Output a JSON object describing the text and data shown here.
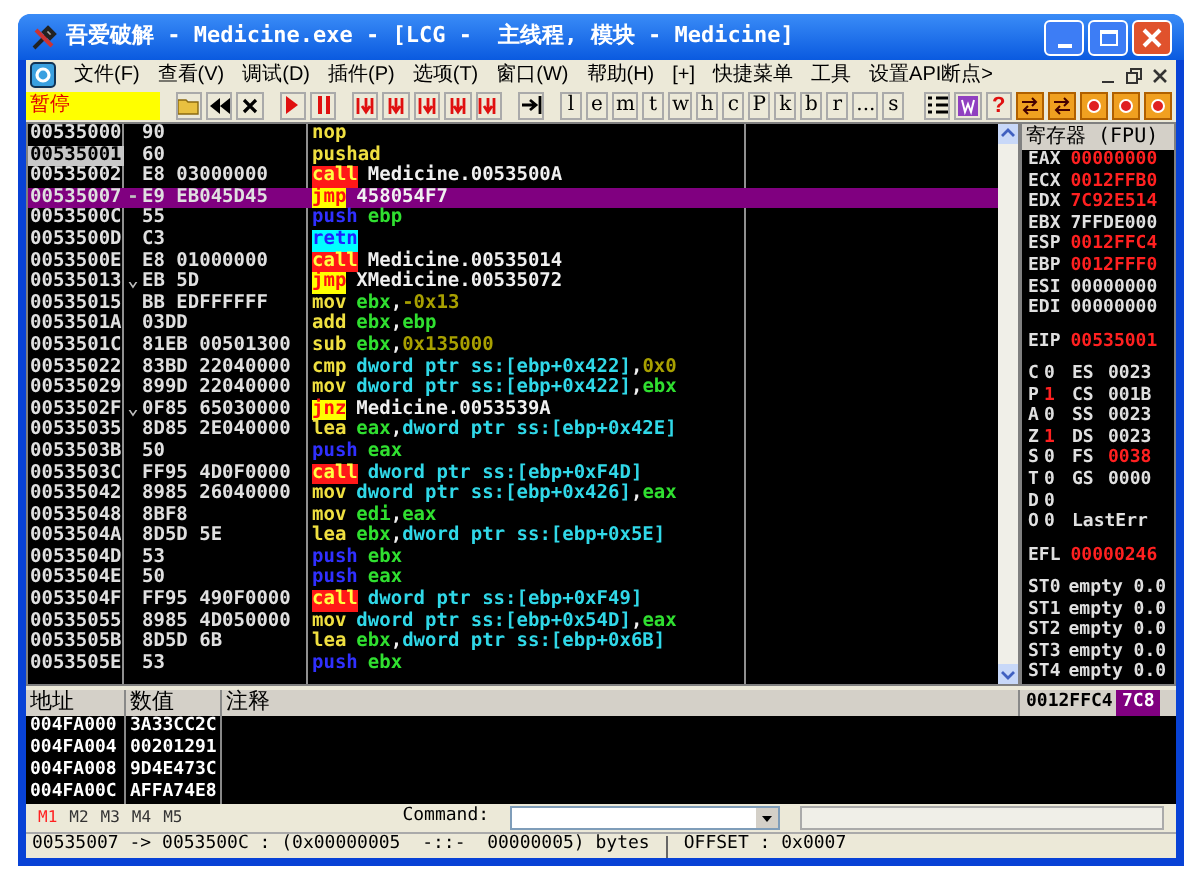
{
  "window": {
    "title": "吾爱破解 - Medicine.exe - [LCG -  主线程, 模块 - Medicine]"
  },
  "menu": {
    "items": [
      "文件(F)",
      "查看(V)",
      "调试(D)",
      "插件(P)",
      "选项(T)",
      "窗口(W)",
      "帮助(H)",
      "[+]",
      "快捷菜单",
      "工具",
      "设置API断点>"
    ]
  },
  "toolbar": {
    "status": "暂停",
    "letters": [
      "l",
      "e",
      "m",
      "t",
      "w",
      "h",
      "c",
      "P",
      "k",
      "b",
      "r",
      "...",
      "s"
    ],
    "help": "?"
  },
  "disassembly": {
    "rows": [
      {
        "address": "00535000",
        "hex": "90",
        "mnemonic": "nop",
        "kind": "plain",
        "operands": [],
        "selected": false,
        "highlighted": false
      },
      {
        "address": "00535001",
        "hex": "60",
        "mnemonic": "pushad",
        "kind": "plain",
        "operands": [],
        "selected": true,
        "highlighted": false
      },
      {
        "address": "00535002",
        "hex": "E8 03000000",
        "mnemonic": "call",
        "kind": "call",
        "operands": [
          {
            "text": "Medicine.0053500A",
            "kind": "label"
          }
        ],
        "selected": false,
        "highlighted": false
      },
      {
        "address": "00535007",
        "marker": "-",
        "hex": "E9 EB045D45",
        "mnemonic": "jmp",
        "kind": "jump",
        "operands": [
          {
            "text": "458054F7",
            "kind": "label"
          }
        ],
        "selected": false,
        "highlighted": true
      },
      {
        "address": "0053500C",
        "hex": "55",
        "mnemonic": "push",
        "kind": "push",
        "operands": [
          {
            "text": "ebp",
            "kind": "reg"
          }
        ],
        "selected": false,
        "highlighted": false
      },
      {
        "address": "0053500D",
        "hex": "C3",
        "mnemonic": "retn",
        "kind": "retn",
        "operands": [],
        "selected": false,
        "highlighted": false
      },
      {
        "address": "0053500E",
        "hex": "E8 01000000",
        "mnemonic": "call",
        "kind": "call",
        "operands": [
          {
            "text": "Medicine.00535014",
            "kind": "label"
          }
        ],
        "selected": false,
        "highlighted": false
      },
      {
        "address": "00535013",
        "marker": "⌄",
        "hex": "EB 5D",
        "mnemonic": "jmp",
        "kind": "jump",
        "operands": [
          {
            "text": "XMedicine.00535072",
            "kind": "label"
          }
        ],
        "selected": false,
        "highlighted": false
      },
      {
        "address": "00535015",
        "hex": "BB EDFFFFFF",
        "mnemonic": "mov",
        "kind": "plain",
        "operands": [
          {
            "text": "ebx",
            "kind": "reg"
          },
          {
            "text": ",",
            "kind": "sep"
          },
          {
            "text": "-0x13",
            "kind": "imm"
          }
        ],
        "selected": false,
        "highlighted": false
      },
      {
        "address": "0053501A",
        "hex": "03DD",
        "mnemonic": "add",
        "kind": "plain",
        "operands": [
          {
            "text": "ebx",
            "kind": "reg"
          },
          {
            "text": ",",
            "kind": "sep"
          },
          {
            "text": "ebp",
            "kind": "reg"
          }
        ],
        "selected": false,
        "highlighted": false
      },
      {
        "address": "0053501C",
        "hex": "81EB 00501300",
        "mnemonic": "sub",
        "kind": "plain",
        "operands": [
          {
            "text": "ebx",
            "kind": "reg"
          },
          {
            "text": ",",
            "kind": "sep"
          },
          {
            "text": "0x135000",
            "kind": "imm"
          }
        ],
        "selected": false,
        "highlighted": false
      },
      {
        "address": "00535022",
        "hex": "83BD 22040000",
        "mnemonic": "cmp",
        "kind": "plain",
        "operands": [
          {
            "text": "dword ptr ss:[ebp+0x422]",
            "kind": "mem"
          },
          {
            "text": ",",
            "kind": "sep"
          },
          {
            "text": "0x0",
            "kind": "imm"
          }
        ],
        "selected": false,
        "highlighted": false
      },
      {
        "address": "00535029",
        "hex": "899D 22040000",
        "mnemonic": "mov",
        "kind": "plain",
        "operands": [
          {
            "text": "dword ptr ss:[ebp+0x422]",
            "kind": "mem"
          },
          {
            "text": ",",
            "kind": "sep"
          },
          {
            "text": "ebx",
            "kind": "reg"
          }
        ],
        "selected": false,
        "highlighted": false
      },
      {
        "address": "0053502F",
        "marker": "⌄",
        "hex": "0F85 65030000",
        "mnemonic": "jnz",
        "kind": "jump",
        "operands": [
          {
            "text": "Medicine.0053539A",
            "kind": "label"
          }
        ],
        "selected": false,
        "highlighted": false
      },
      {
        "address": "00535035",
        "hex": "8D85 2E040000",
        "mnemonic": "lea",
        "kind": "plain",
        "operands": [
          {
            "text": "eax",
            "kind": "reg"
          },
          {
            "text": ",",
            "kind": "sep"
          },
          {
            "text": "dword ptr ss:[ebp+0x42E]",
            "kind": "mem"
          }
        ],
        "selected": false,
        "highlighted": false
      },
      {
        "address": "0053503B",
        "hex": "50",
        "mnemonic": "push",
        "kind": "push",
        "operands": [
          {
            "text": "eax",
            "kind": "reg"
          }
        ],
        "selected": false,
        "highlighted": false
      },
      {
        "address": "0053503C",
        "hex": "FF95 4D0F0000",
        "mnemonic": "call",
        "kind": "call",
        "operands": [
          {
            "text": "dword ptr ss:[ebp+0xF4D]",
            "kind": "mem"
          }
        ],
        "selected": false,
        "highlighted": false
      },
      {
        "address": "00535042",
        "hex": "8985 26040000",
        "mnemonic": "mov",
        "kind": "plain",
        "operands": [
          {
            "text": "dword ptr ss:[ebp+0x426]",
            "kind": "mem"
          },
          {
            "text": ",",
            "kind": "sep"
          },
          {
            "text": "eax",
            "kind": "reg"
          }
        ],
        "selected": false,
        "highlighted": false
      },
      {
        "address": "00535048",
        "hex": "8BF8",
        "mnemonic": "mov",
        "kind": "plain",
        "operands": [
          {
            "text": "edi",
            "kind": "reg"
          },
          {
            "text": ",",
            "kind": "sep"
          },
          {
            "text": "eax",
            "kind": "reg"
          }
        ],
        "selected": false,
        "highlighted": false
      },
      {
        "address": "0053504A",
        "hex": "8D5D 5E",
        "mnemonic": "lea",
        "kind": "plain",
        "operands": [
          {
            "text": "ebx",
            "kind": "reg"
          },
          {
            "text": ",",
            "kind": "sep"
          },
          {
            "text": "dword ptr ss:[ebp+0x5E]",
            "kind": "mem"
          }
        ],
        "selected": false,
        "highlighted": false
      },
      {
        "address": "0053504D",
        "hex": "53",
        "mnemonic": "push",
        "kind": "push",
        "operands": [
          {
            "text": "ebx",
            "kind": "reg"
          }
        ],
        "selected": false,
        "highlighted": false
      },
      {
        "address": "0053504E",
        "hex": "50",
        "mnemonic": "push",
        "kind": "push",
        "operands": [
          {
            "text": "eax",
            "kind": "reg"
          }
        ],
        "selected": false,
        "highlighted": false
      },
      {
        "address": "0053504F",
        "hex": "FF95 490F0000",
        "mnemonic": "call",
        "kind": "call",
        "operands": [
          {
            "text": "dword ptr ss:[ebp+0xF49]",
            "kind": "mem"
          }
        ],
        "selected": false,
        "highlighted": false
      },
      {
        "address": "00535055",
        "hex": "8985 4D050000",
        "mnemonic": "mov",
        "kind": "plain",
        "operands": [
          {
            "text": "dword ptr ss:[ebp+0x54D]",
            "kind": "mem"
          },
          {
            "text": ",",
            "kind": "sep"
          },
          {
            "text": "eax",
            "kind": "reg"
          }
        ],
        "selected": false,
        "highlighted": false
      },
      {
        "address": "0053505B",
        "hex": "8D5D 6B",
        "mnemonic": "lea",
        "kind": "plain",
        "operands": [
          {
            "text": "ebx",
            "kind": "reg"
          },
          {
            "text": ",",
            "kind": "sep"
          },
          {
            "text": "dword ptr ss:[ebp+0x6B]",
            "kind": "mem"
          }
        ],
        "selected": false,
        "highlighted": false
      },
      {
        "address": "0053505E",
        "hex": "53",
        "mnemonic": "push",
        "kind": "push",
        "operands": [
          {
            "text": "ebx",
            "kind": "reg"
          }
        ],
        "selected": false,
        "highlighted": false
      }
    ]
  },
  "registers": {
    "title": "寄存器 (FPU)",
    "general": [
      {
        "name": "EAX",
        "value": "00000000",
        "changed": true
      },
      {
        "name": "ECX",
        "value": "0012FFB0",
        "changed": true
      },
      {
        "name": "EDX",
        "value": "7C92E514",
        "changed": true
      },
      {
        "name": "EBX",
        "value": "7FFDE000",
        "changed": false
      },
      {
        "name": "ESP",
        "value": "0012FFC4",
        "changed": true
      },
      {
        "name": "EBP",
        "value": "0012FFF0",
        "changed": true
      },
      {
        "name": "ESI",
        "value": "00000000",
        "changed": false
      },
      {
        "name": "EDI",
        "value": "00000000",
        "changed": false
      }
    ],
    "eip": {
      "name": "EIP",
      "value": "00535001",
      "changed": true
    },
    "flags": [
      {
        "flag": "C",
        "value": "0",
        "changed": false,
        "segment": "ES",
        "segment_value": "0023",
        "segment_changed": false
      },
      {
        "flag": "P",
        "value": "1",
        "changed": true,
        "segment": "CS",
        "segment_value": "001B",
        "segment_changed": false
      },
      {
        "flag": "A",
        "value": "0",
        "changed": false,
        "segment": "SS",
        "segment_value": "0023",
        "segment_changed": false
      },
      {
        "flag": "Z",
        "value": "1",
        "changed": true,
        "segment": "DS",
        "segment_value": "0023",
        "segment_changed": false
      },
      {
        "flag": "S",
        "value": "0",
        "changed": false,
        "segment": "FS",
        "segment_value": "0038",
        "segment_changed": true
      },
      {
        "flag": "T",
        "value": "0",
        "changed": false,
        "segment": "GS",
        "segment_value": "0000",
        "segment_changed": false
      },
      {
        "flag": "D",
        "value": "0",
        "changed": false
      },
      {
        "flag": "O",
        "value": "0",
        "changed": false,
        "note": "LastErr"
      }
    ],
    "efl": {
      "name": "EFL",
      "value": "00000246",
      "changed": true
    },
    "fpu": [
      {
        "name": "ST0",
        "value": "empty 0.0"
      },
      {
        "name": "ST1",
        "value": "empty 0.0"
      },
      {
        "name": "ST2",
        "value": "empty 0.0"
      },
      {
        "name": "ST3",
        "value": "empty 0.0"
      },
      {
        "name": "ST4",
        "value": "empty 0.0"
      }
    ]
  },
  "dump": {
    "columns": [
      "地址",
      "数值",
      "注释"
    ],
    "rows": [
      {
        "address": "004FA000",
        "value": "3A33CC2C"
      },
      {
        "address": "004FA004",
        "value": "00201291"
      },
      {
        "address": "004FA008",
        "value": "9D4E473C"
      },
      {
        "address": "004FA00C",
        "value": "AFFA74E8"
      }
    ]
  },
  "stack": {
    "address": "0012FFC4",
    "value": "7C8"
  },
  "memory_tabs": [
    {
      "label": "M1",
      "selected": true
    },
    {
      "label": "M2",
      "selected": false
    },
    {
      "label": "M3",
      "selected": false
    },
    {
      "label": "M4",
      "selected": false
    },
    {
      "label": "M5",
      "selected": false
    }
  ],
  "command": {
    "label": "Command:"
  },
  "status_bar": {
    "left": "00535007 -> 0053500C : (0x00000005  -::-  00000005) bytes",
    "right": "OFFSET : 0x0007"
  }
}
